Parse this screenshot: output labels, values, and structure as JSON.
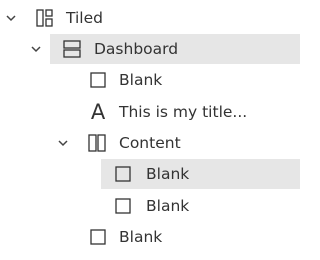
{
  "tree": {
    "root": {
      "label": "Tiled",
      "icon": "tiled-container-icon",
      "expanded": true
    },
    "dashboard": {
      "label": "Dashboard",
      "icon": "vertical-layout-icon",
      "expanded": true,
      "selected": true
    },
    "blank1": {
      "label": "Blank",
      "icon": "blank-object-icon"
    },
    "title": {
      "label": "This is my title...",
      "icon": "text-object-icon",
      "glyph": "A"
    },
    "content": {
      "label": "Content",
      "icon": "horizontal-layout-icon",
      "expanded": true
    },
    "content_blank1": {
      "label": "Blank",
      "icon": "blank-object-icon",
      "selected": true
    },
    "content_blank2": {
      "label": "Blank",
      "icon": "blank-object-icon"
    },
    "blank2": {
      "label": "Blank",
      "icon": "blank-object-icon"
    }
  },
  "colors": {
    "selection_bg": "#e6e6e6",
    "text": "#333333",
    "icon_stroke": "#333333"
  }
}
